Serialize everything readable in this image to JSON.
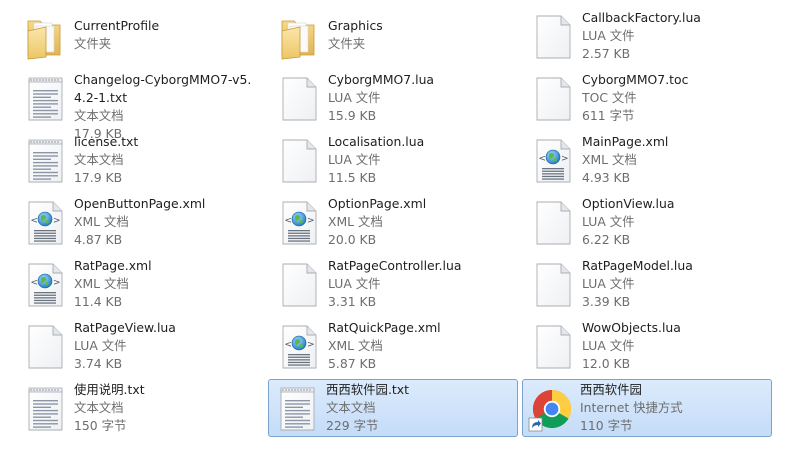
{
  "items": [
    {
      "name": "CurrentProfile",
      "type": "文件夹",
      "size": "",
      "icon": "folder-icon"
    },
    {
      "name": "Graphics",
      "type": "文件夹",
      "size": "",
      "icon": "folder-icon"
    },
    {
      "name": "CallbackFactory.lua",
      "type": "LUA 文件",
      "size": "2.57 KB",
      "icon": "blank-file-icon"
    },
    {
      "name": "Changelog-CyborgMMO7-v5.4.2-1.txt",
      "type": "文本文档",
      "size": "17.9 KB",
      "icon": "text-file-icon"
    },
    {
      "name": "CyborgMMO7.lua",
      "type": "LUA 文件",
      "size": "15.9 KB",
      "icon": "blank-file-icon"
    },
    {
      "name": "CyborgMMO7.toc",
      "type": "TOC 文件",
      "size": "611 字节",
      "icon": "blank-file-icon"
    },
    {
      "name": "license.txt",
      "type": "文本文档",
      "size": "17.9 KB",
      "icon": "text-file-icon"
    },
    {
      "name": "Localisation.lua",
      "type": "LUA 文件",
      "size": "11.5 KB",
      "icon": "blank-file-icon"
    },
    {
      "name": "MainPage.xml",
      "type": "XML 文档",
      "size": "4.93 KB",
      "icon": "xml-file-icon"
    },
    {
      "name": "OpenButtonPage.xml",
      "type": "XML 文档",
      "size": "4.87 KB",
      "icon": "xml-file-icon"
    },
    {
      "name": "OptionPage.xml",
      "type": "XML 文档",
      "size": "20.0 KB",
      "icon": "xml-file-icon"
    },
    {
      "name": "OptionView.lua",
      "type": "LUA 文件",
      "size": "6.22 KB",
      "icon": "blank-file-icon"
    },
    {
      "name": "RatPage.xml",
      "type": "XML 文档",
      "size": "11.4 KB",
      "icon": "xml-file-icon"
    },
    {
      "name": "RatPageController.lua",
      "type": "LUA 文件",
      "size": "3.31 KB",
      "icon": "blank-file-icon"
    },
    {
      "name": "RatPageModel.lua",
      "type": "LUA 文件",
      "size": "3.39 KB",
      "icon": "blank-file-icon"
    },
    {
      "name": "RatPageView.lua",
      "type": "LUA 文件",
      "size": "3.74 KB",
      "icon": "blank-file-icon"
    },
    {
      "name": "RatQuickPage.xml",
      "type": "XML 文档",
      "size": "5.87 KB",
      "icon": "xml-file-icon"
    },
    {
      "name": "WowObjects.lua",
      "type": "LUA 文件",
      "size": "12.0 KB",
      "icon": "blank-file-icon"
    },
    {
      "name": "使用说明.txt",
      "type": "文本文档",
      "size": "150 字节",
      "icon": "text-file-icon"
    },
    {
      "name": "西西软件园.txt",
      "type": "文本文档",
      "size": "229 字节",
      "icon": "text-file-icon",
      "selected": true
    },
    {
      "name": "西西软件园",
      "type": "Internet 快捷方式",
      "size": "110 字节",
      "icon": "chrome-shortcut-icon",
      "selected": true
    }
  ],
  "colors": {
    "selection_fill": "#cfe3fb",
    "selection_border": "#7da2ce",
    "secondary_text": "#6d6d6d",
    "folder": "#f3d27a"
  }
}
